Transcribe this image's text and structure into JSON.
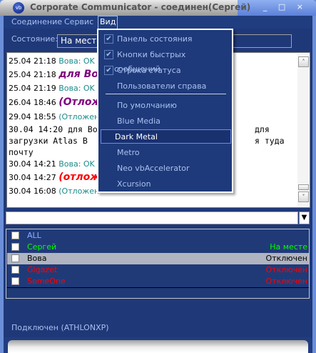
{
  "window": {
    "title": "Corporate Communicator - соединен(Сергей)",
    "logo": "vb"
  },
  "menu": {
    "items": [
      "Соединение",
      "Сервис",
      "Вид"
    ]
  },
  "status": {
    "label": "Состояние:",
    "value": "На месте"
  },
  "chat": {
    "messages": [
      {
        "time": "25.04 21:18",
        "text": "Вова: OK"
      },
      {
        "time": "25.04 21:18",
        "text": "для Вов"
      },
      {
        "time": "25.04 21:19",
        "text": "Вова: OK"
      },
      {
        "time": "26.04 18:46",
        "text": "(Отлож"
      },
      {
        "time": "29.04 18:55",
        "text": "(Отложен"
      },
      {
        "time": "30.04 14:20",
        "text": "для Вова",
        "tail": "для"
      },
      {
        "line2": "загрузки Atlas B",
        "tail": "я туда"
      },
      {
        "line3": "почту"
      },
      {
        "time": "30.04 14:21",
        "text": "Вова: OK"
      },
      {
        "time": "30.04 14:27",
        "text": "(отложе"
      },
      {
        "time": "30.04 16:08",
        "text": "(Отложен"
      }
    ]
  },
  "users": [
    {
      "name": "ALL",
      "status": "",
      "color": "#8fb0ff"
    },
    {
      "name": "Сергей",
      "status": "На месте",
      "color": "#00ff00"
    },
    {
      "name": "Вова",
      "status": "Отключен",
      "color": "#000000"
    },
    {
      "name": "Gigazet",
      "status": "Отключен",
      "color": "#ff0000"
    },
    {
      "name": "SomeOne",
      "status": "Отключен",
      "color": "#ff0000"
    }
  ],
  "statusbar": "Подключен (ATHLONXP)",
  "view_menu": {
    "checks": [
      "Панель состояния",
      "Кнопки быстрых сообщений",
      "Строка статуса"
    ],
    "plain": "Пользователи справа",
    "skins": [
      "По умолчанию",
      "Blue Media",
      "Dark Metal",
      "Metro",
      "Neo vbAccelerator",
      "Xcursion"
    ],
    "highlighted": "Dark Metal"
  },
  "glyphs": {
    "check": "✔",
    "down": "▼",
    "up": "˄",
    "scrolldown": "˅",
    "controls": "_ □ ×"
  }
}
